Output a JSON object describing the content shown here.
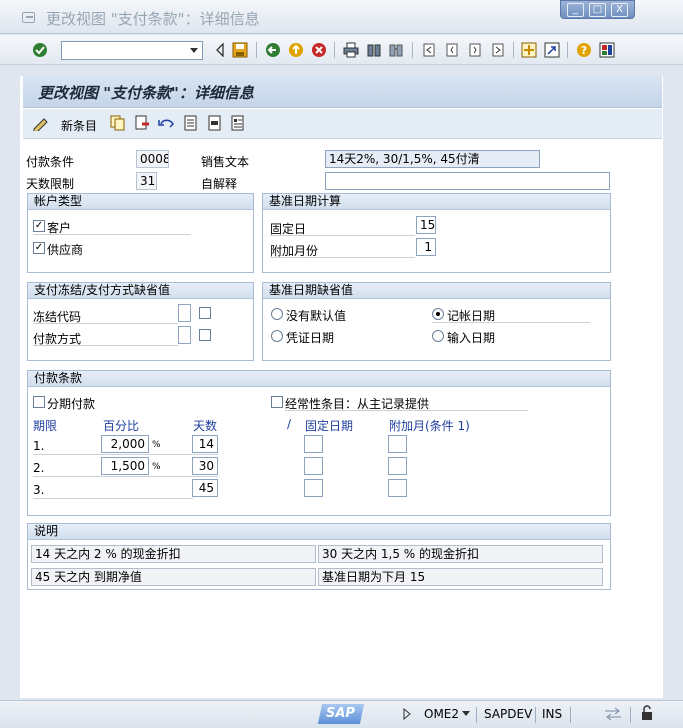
{
  "window": {
    "title": "更改视图 \"支付条款\"：详细信息",
    "controls": [
      "_",
      "□",
      "X"
    ]
  },
  "command": {
    "value": "",
    "placeholder": ""
  },
  "header": {
    "title": "更改视图 \"支付条款\"：详细信息"
  },
  "app_toolbar": {
    "new_entries_label": "新条目"
  },
  "fields": {
    "payment_term_label": "付款条件",
    "payment_term_value": "0008",
    "sales_text_label": "销售文本",
    "sales_text_value": "14天2%, 30/1,5%, 45付清",
    "day_limit_label": "天数限制",
    "day_limit_value": "31",
    "own_explanation_label": "自解释",
    "own_explanation_value": ""
  },
  "account_type": {
    "title": "帐户类型",
    "customer_label": "客户",
    "customer_checked": "✓",
    "vendor_label": "供应商",
    "vendor_checked": "✓"
  },
  "baseline_calc": {
    "title": "基准日期计算",
    "fixed_day_label": "固定日",
    "fixed_day_value": "15",
    "add_months_label": "附加月份",
    "add_months_value": "1"
  },
  "block_defaults": {
    "title": "支付冻结/支付方式缺省值",
    "block_key_label": "冻结代码",
    "payment_method_label": "付款方式"
  },
  "baseline_default": {
    "title": "基准日期缺省值",
    "no_default_label": "没有默认值",
    "posting_date_label": "记帐日期",
    "document_date_label": "凭证日期",
    "entry_date_label": "输入日期"
  },
  "terms": {
    "title": "付款条款",
    "installment_label": "分期付款",
    "recurring_label": "经常性条目：从主记录提供",
    "col_term": "期限",
    "col_percent": "百分比",
    "col_days": "天数",
    "col_slash": "/",
    "col_fixed_date": "固定日期",
    "col_add_months": "附加月(条件 1)",
    "rows": [
      {
        "term": "1.",
        "percent": "2,000",
        "unit": "%",
        "days": "14"
      },
      {
        "term": "2.",
        "percent": "1,500",
        "unit": "%",
        "days": "30"
      },
      {
        "term": "3.",
        "percent": "",
        "unit": "",
        "days": "45"
      }
    ]
  },
  "explanation": {
    "title": "说明",
    "lines": [
      "14 天之内 2 % 的现金折扣",
      "30 天之内 1,5 % 的现金折扣",
      "45 天之内 到期净值",
      "基准日期为下月 15"
    ]
  },
  "status": {
    "logo": "SAP",
    "transaction": "OME2",
    "system": "SAPDEV",
    "mode": "INS"
  },
  "colors": {
    "accent": "#1f3f9f",
    "header_bg": "#c4d4e9"
  }
}
